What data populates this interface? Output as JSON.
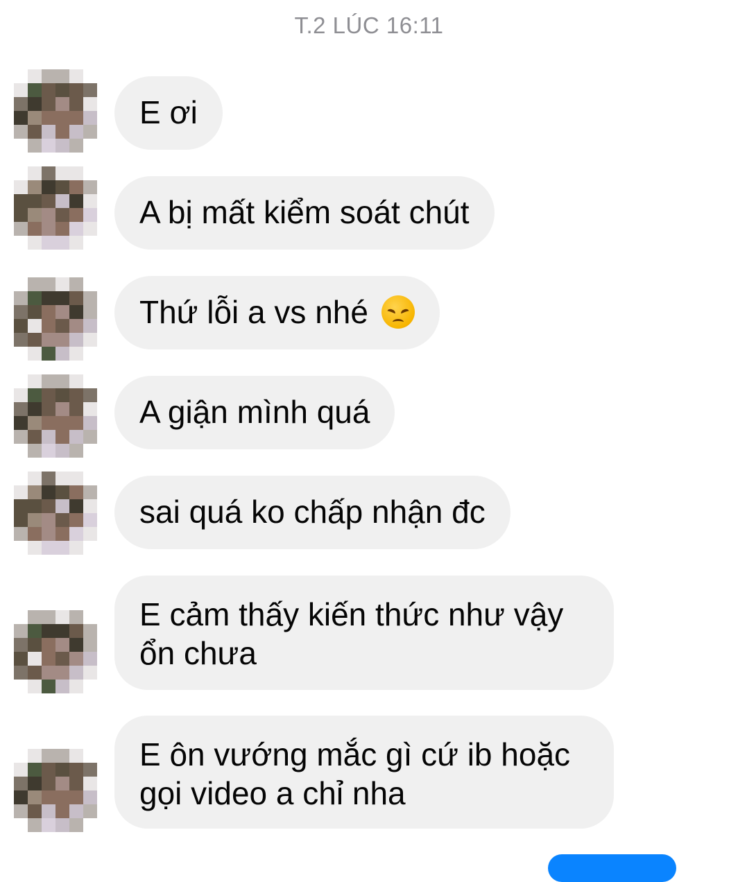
{
  "chat": {
    "timestamp": "T.2 LÚC 16:11",
    "messages": [
      {
        "text": "E ơi"
      },
      {
        "text": "A bị mất kiểm soát chút"
      },
      {
        "text": "Thứ lỗi a vs nhé",
        "emoji": "disappointed-face-emoji"
      },
      {
        "text": "A giận mình quá"
      },
      {
        "text": "sai quá ko chấp nhận đc"
      },
      {
        "line1": "E cảm thấy kiến thức như vậy",
        "line2": "ổn chưa"
      },
      {
        "line1": "E ôn vướng mắc gì cứ ib hoặc",
        "line2": "gọi video a chỉ nha"
      }
    ]
  },
  "colors": {
    "incoming_bubble": "#f0f0f0",
    "outgoing_bubble": "#0a84ff",
    "timestamp_text": "#8e8e93",
    "message_text": "#050505"
  },
  "avatar": {
    "style": "pixelated-blurred-avatar",
    "palette": [
      "#e9e6e6",
      "#b9b3ae",
      "#7d7368",
      "#5a5040",
      "#3f3a2f",
      "#6b5a4b",
      "#8a6e5f",
      "#a38b85",
      "#c7bec8",
      "#d9d0dc",
      "#4c5a40",
      "#9a8a7a"
    ]
  }
}
